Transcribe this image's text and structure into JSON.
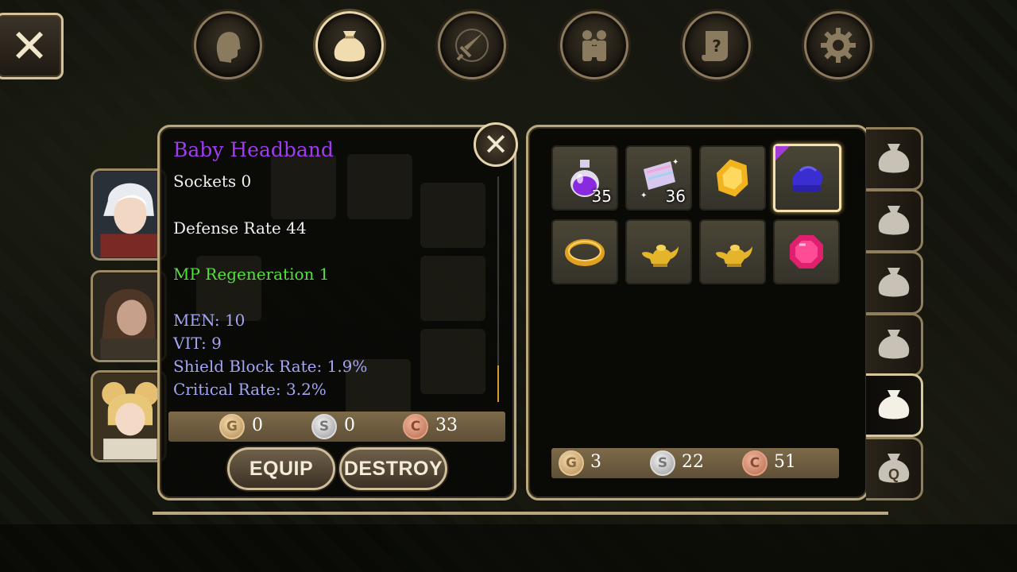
{
  "top_menu": {
    "buttons": [
      {
        "name": "character",
        "icon": "head-icon",
        "active": false
      },
      {
        "name": "inventory",
        "icon": "bag-icon",
        "active": true
      },
      {
        "name": "skills",
        "icon": "sword-icon",
        "active": false
      },
      {
        "name": "party",
        "icon": "people-icon",
        "active": false
      },
      {
        "name": "quests",
        "icon": "scroll-icon",
        "active": false
      },
      {
        "name": "settings",
        "icon": "gear-icon",
        "active": false
      }
    ]
  },
  "close_label": "✕",
  "item": {
    "name": "Baby Headband",
    "sockets": "Sockets 0",
    "defense": "Defense Rate 44",
    "bonus": "MP Regeneration 1",
    "stats": [
      "MEN: 10",
      "VIT: 9",
      "Shield Block Rate: 1.9%",
      "Critical Rate: 3.2%"
    ],
    "price": {
      "gold": "0",
      "silver": "0",
      "copper": "33"
    },
    "equip_label": "EQUIP",
    "destroy_label": "DESTROY"
  },
  "coin_letters": {
    "gold": "G",
    "silver": "S",
    "copper": "C"
  },
  "inventory": {
    "slots": [
      {
        "item": "purple-potion-icon",
        "qty": "35",
        "selected": false
      },
      {
        "item": "magic-scroll-icon",
        "qty": "36",
        "selected": false
      },
      {
        "item": "yellow-gem-icon",
        "qty": "",
        "selected": false
      },
      {
        "item": "blue-headband-icon",
        "qty": "",
        "selected": true
      },
      {
        "item": "gold-ring-icon",
        "qty": "",
        "selected": false
      },
      {
        "item": "genie-lamp-icon",
        "qty": "",
        "selected": false
      },
      {
        "item": "genie-lamp-icon",
        "qty": "",
        "selected": false
      },
      {
        "item": "red-gem-icon",
        "qty": "",
        "selected": false
      }
    ],
    "money": {
      "gold": "3",
      "silver": "22",
      "copper": "51"
    }
  },
  "bag_tabs": [
    {
      "label": "",
      "active": false
    },
    {
      "label": "",
      "active": false
    },
    {
      "label": "",
      "active": false
    },
    {
      "label": "",
      "active": false
    },
    {
      "label": "",
      "active": true
    },
    {
      "label": "Q",
      "active": false
    }
  ],
  "colors": {
    "item_name": "#9f3cf2",
    "bonus_stat": "#53e23b",
    "stat": "#a4a6f4",
    "border": "#b8a77f"
  }
}
